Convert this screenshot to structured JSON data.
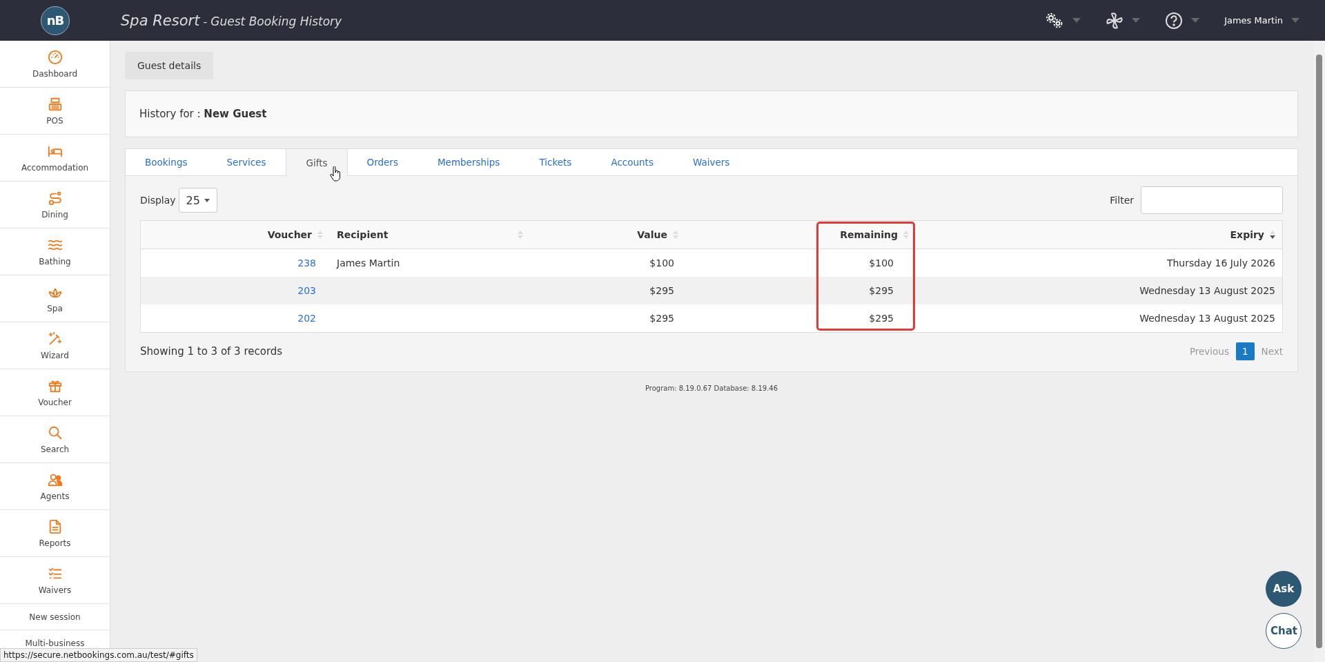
{
  "header": {
    "logo": "nB",
    "title": "Spa Resort",
    "separator": "-",
    "subtitle": "Guest Booking History",
    "user": "James Martin"
  },
  "sidebar": {
    "items": [
      {
        "kind": "icon",
        "label": "Dashboard"
      },
      {
        "kind": "icon",
        "label": "POS"
      },
      {
        "kind": "icon",
        "label": "Accommodation"
      },
      {
        "kind": "icon",
        "label": "Dining"
      },
      {
        "kind": "icon",
        "label": "Bathing"
      },
      {
        "kind": "icon",
        "label": "Spa"
      },
      {
        "kind": "icon",
        "label": "Wizard"
      },
      {
        "kind": "icon",
        "label": "Voucher"
      },
      {
        "kind": "icon",
        "label": "Search"
      },
      {
        "kind": "icon",
        "label": "Agents"
      },
      {
        "kind": "icon",
        "label": "Reports"
      },
      {
        "kind": "icon",
        "label": "Waivers"
      },
      {
        "kind": "text",
        "label": "New session"
      },
      {
        "kind": "text",
        "label": "Multi-business"
      }
    ]
  },
  "guest_details_button": "Guest details",
  "history": {
    "label": "History for :",
    "guest": "New Guest"
  },
  "tabs": [
    {
      "label": "Bookings",
      "selected": false
    },
    {
      "label": "Services",
      "selected": false
    },
    {
      "label": "Gifts",
      "selected": true
    },
    {
      "label": "Orders",
      "selected": false
    },
    {
      "label": "Memberships",
      "selected": false
    },
    {
      "label": "Tickets",
      "selected": false
    },
    {
      "label": "Accounts",
      "selected": false
    },
    {
      "label": "Waivers",
      "selected": false
    }
  ],
  "display": {
    "label": "Display",
    "value": "25"
  },
  "filter": {
    "label": "Filter"
  },
  "table": {
    "columns": [
      {
        "label": "Voucher",
        "sorted_descending": false
      },
      {
        "label": "Recipient",
        "sorted_descending": false
      },
      {
        "label": "Value",
        "sorted_descending": false
      },
      {
        "label": "Remaining",
        "sorted_descending": false,
        "highlighted": true
      },
      {
        "label": "Expiry",
        "sorted_descending": true
      }
    ],
    "rows": [
      [
        "238",
        "James Martin",
        "$100",
        "$100",
        "Thursday 16 July 2026"
      ],
      [
        "203",
        "",
        "$295",
        "$295",
        "Wednesday 13 August 2025"
      ],
      [
        "202",
        "",
        "$295",
        "$295",
        "Wednesday 13 August 2025"
      ]
    ]
  },
  "summary": "Showing 1 to 3 of 3 records",
  "pagination": {
    "previous": {
      "label": "Previous",
      "disabled": true
    },
    "pages": [
      {
        "label": "1",
        "selected": true
      }
    ],
    "next": {
      "label": "Next",
      "disabled": true
    }
  },
  "footer": "Program: 8.19.0.67 Database: 8.19.46",
  "ask_button": "Ask",
  "chat_button": "Chat",
  "status_bar": "https://secure.netbookings.com.au/test/#gifts"
}
